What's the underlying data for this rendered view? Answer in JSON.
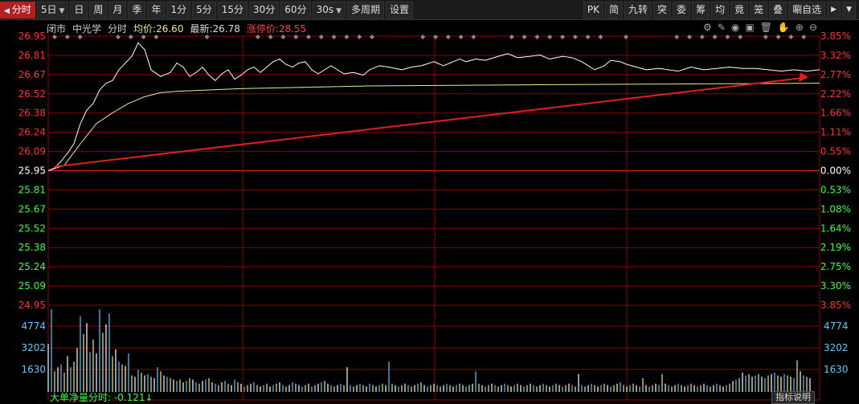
{
  "toolbar": {
    "left": [
      {
        "label": "分时",
        "active": true,
        "icon": "play-left-icon"
      },
      {
        "label": "5日",
        "dropdown": true
      },
      {
        "label": "日"
      },
      {
        "label": "周"
      },
      {
        "label": "月"
      },
      {
        "label": "季"
      },
      {
        "label": "年"
      },
      {
        "label": "1分"
      },
      {
        "label": "5分"
      },
      {
        "label": "15分"
      },
      {
        "label": "30分"
      },
      {
        "label": "60分"
      },
      {
        "label": "30s",
        "dropdown": true
      },
      {
        "label": "多周期"
      },
      {
        "label": "设置"
      }
    ],
    "right": [
      "PK",
      "简",
      "九转",
      "突",
      "委",
      "筹",
      "均",
      "竟",
      "笼",
      "叠",
      "唰自选"
    ]
  },
  "info": {
    "market": "闭市",
    "stock": "中光学",
    "mode": "分时",
    "avg_label": "均价:",
    "avg_value": "26.60",
    "last_label": "最新:",
    "last_value": "26.78",
    "limit_label": "涨停价:",
    "limit_value": "28.55"
  },
  "tools": [
    "gear-icon",
    "pen-icon",
    "eye-icon",
    "box-icon",
    "trash-icon",
    "hand-icon",
    "plus-icon",
    "minus-icon"
  ],
  "bottom": {
    "indicator_label": "大单净量分时: -0.121↓",
    "help_label": "指标说明"
  },
  "colors": {
    "grid": "#8b0000",
    "price_line": "#ffffff",
    "avg_line": "#f0e68c",
    "up": "#ff3030",
    "down": "#39ff39",
    "volume": "#5cc8ff",
    "arrow": "#e02020"
  },
  "chart_data": {
    "type": "line",
    "y_ticks_price": [
      "26.95",
      "26.81",
      "26.67",
      "26.52",
      "26.38",
      "26.24",
      "26.09",
      "25.95",
      "25.81",
      "25.67",
      "25.52",
      "25.38",
      "25.24",
      "25.09",
      "24.95"
    ],
    "y_ticks_pct": [
      "3.85%",
      "3.32%",
      "2.77%",
      "2.22%",
      "1.66%",
      "1.11%",
      "0.55%",
      "0.00%",
      "0.53%",
      "1.08%",
      "1.64%",
      "2.19%",
      "2.75%",
      "3.30%",
      "3.85%"
    ],
    "ylim": [
      24.95,
      26.95
    ],
    "prev_close": 25.95,
    "volume_ticks": [
      "4774",
      "3202",
      "1630"
    ],
    "volume_max": 6300,
    "n_points": 241,
    "series": [
      {
        "kind": "price",
        "anchors": [
          [
            0,
            25.95
          ],
          [
            2,
            25.97
          ],
          [
            4,
            26.02
          ],
          [
            6,
            26.08
          ],
          [
            8,
            26.15
          ],
          [
            10,
            26.3
          ],
          [
            12,
            26.4
          ],
          [
            14,
            26.45
          ],
          [
            16,
            26.55
          ],
          [
            18,
            26.6
          ],
          [
            20,
            26.62
          ],
          [
            22,
            26.7
          ],
          [
            24,
            26.75
          ],
          [
            26,
            26.8
          ],
          [
            28,
            26.9
          ],
          [
            30,
            26.85
          ],
          [
            32,
            26.7
          ],
          [
            35,
            26.65
          ],
          [
            38,
            26.68
          ],
          [
            40,
            26.75
          ],
          [
            42,
            26.72
          ],
          [
            44,
            26.65
          ],
          [
            46,
            26.68
          ],
          [
            48,
            26.72
          ],
          [
            50,
            26.66
          ],
          [
            52,
            26.62
          ],
          [
            54,
            26.67
          ],
          [
            56,
            26.7
          ],
          [
            58,
            26.63
          ],
          [
            60,
            26.66
          ],
          [
            62,
            26.7
          ],
          [
            64,
            26.72
          ],
          [
            66,
            26.68
          ],
          [
            68,
            26.72
          ],
          [
            70,
            26.76
          ],
          [
            72,
            26.78
          ],
          [
            74,
            26.74
          ],
          [
            76,
            26.72
          ],
          [
            78,
            26.75
          ],
          [
            80,
            26.76
          ],
          [
            82,
            26.7
          ],
          [
            84,
            26.67
          ],
          [
            86,
            26.7
          ],
          [
            88,
            26.73
          ],
          [
            90,
            26.7
          ],
          [
            92,
            26.67
          ],
          [
            95,
            26.68
          ],
          [
            98,
            26.66
          ],
          [
            100,
            26.7
          ],
          [
            103,
            26.73
          ],
          [
            106,
            26.72
          ],
          [
            110,
            26.7
          ],
          [
            113,
            26.72
          ],
          [
            116,
            26.73
          ],
          [
            120,
            26.76
          ],
          [
            123,
            26.73
          ],
          [
            126,
            26.76
          ],
          [
            128,
            26.78
          ],
          [
            130,
            26.76
          ],
          [
            133,
            26.78
          ],
          [
            136,
            26.77
          ],
          [
            140,
            26.8
          ],
          [
            143,
            26.82
          ],
          [
            146,
            26.79
          ],
          [
            150,
            26.8
          ],
          [
            153,
            26.81
          ],
          [
            156,
            26.78
          ],
          [
            160,
            26.8
          ],
          [
            163,
            26.79
          ],
          [
            166,
            26.76
          ],
          [
            168,
            26.73
          ],
          [
            170,
            26.7
          ],
          [
            173,
            26.73
          ],
          [
            175,
            26.77
          ],
          [
            178,
            26.76
          ],
          [
            180,
            26.74
          ],
          [
            183,
            26.72
          ],
          [
            186,
            26.7
          ],
          [
            190,
            26.71
          ],
          [
            193,
            26.7
          ],
          [
            196,
            26.69
          ],
          [
            200,
            26.72
          ],
          [
            204,
            26.7
          ],
          [
            208,
            26.71
          ],
          [
            212,
            26.72
          ],
          [
            216,
            26.71
          ],
          [
            220,
            26.71
          ],
          [
            224,
            26.7
          ],
          [
            228,
            26.69
          ],
          [
            232,
            26.7
          ],
          [
            236,
            26.69
          ],
          [
            240,
            26.7
          ]
        ]
      },
      {
        "kind": "avg",
        "anchors": [
          [
            0,
            25.95
          ],
          [
            5,
            25.99
          ],
          [
            10,
            26.15
          ],
          [
            15,
            26.3
          ],
          [
            20,
            26.38
          ],
          [
            25,
            26.45
          ],
          [
            30,
            26.5
          ],
          [
            35,
            26.53
          ],
          [
            40,
            26.54
          ],
          [
            60,
            26.56
          ],
          [
            100,
            26.58
          ],
          [
            160,
            26.59
          ],
          [
            240,
            26.6
          ]
        ]
      },
      {
        "kind": "volume",
        "values": [
          3500,
          6000,
          1500,
          1800,
          2000,
          1400,
          2600,
          1800,
          2200,
          3200,
          5500,
          4200,
          5000,
          2900,
          3800,
          2800,
          6000,
          4300,
          4900,
          5700,
          2600,
          3100,
          2200,
          2000,
          1900,
          2800,
          1200,
          1100,
          1600,
          1400,
          1200,
          1300,
          1100,
          1000,
          1800,
          1500,
          1200,
          1100,
          1000,
          900,
          800,
          900,
          700,
          800,
          1000,
          900,
          700,
          600,
          800,
          900,
          1000,
          700,
          600,
          500,
          700,
          800,
          600,
          500,
          900,
          700,
          600,
          400,
          500,
          600,
          700,
          500,
          400,
          500,
          600,
          400,
          500,
          600,
          700,
          500,
          400,
          500,
          700,
          600,
          500,
          400,
          500,
          600,
          400,
          500,
          600,
          700,
          800,
          600,
          500,
          400,
          500,
          600,
          500,
          1800,
          500,
          400,
          500,
          600,
          500,
          400,
          600,
          500,
          400,
          500,
          600,
          500,
          2200,
          600,
          500,
          400,
          500,
          600,
          500,
          400,
          500,
          600,
          700,
          500,
          400,
          500,
          600,
          500,
          400,
          500,
          600,
          500,
          400,
          500,
          600,
          500,
          400,
          500,
          600,
          1500,
          600,
          500,
          400,
          500,
          600,
          500,
          400,
          500,
          600,
          500,
          400,
          500,
          600,
          500,
          400,
          500,
          600,
          500,
          400,
          500,
          600,
          500,
          400,
          500,
          600,
          500,
          400,
          500,
          600,
          500,
          400,
          1300,
          500,
          400,
          500,
          600,
          500,
          400,
          500,
          600,
          500,
          400,
          500,
          600,
          700,
          500,
          400,
          500,
          600,
          500,
          400,
          1000,
          500,
          400,
          500,
          600,
          500,
          1300,
          600,
          500,
          400,
          500,
          600,
          500,
          400,
          500,
          600,
          500,
          400,
          500,
          600,
          500,
          400,
          500,
          600,
          500,
          400,
          500,
          600,
          800,
          900,
          1000,
          1400,
          1200,
          1300,
          1100,
          1200,
          1300,
          1100,
          1000,
          1200,
          1300,
          1400,
          1200,
          1100,
          1300,
          1200,
          1100,
          1000,
          2300,
          1500,
          1200,
          1100,
          1000
        ]
      }
    ]
  }
}
